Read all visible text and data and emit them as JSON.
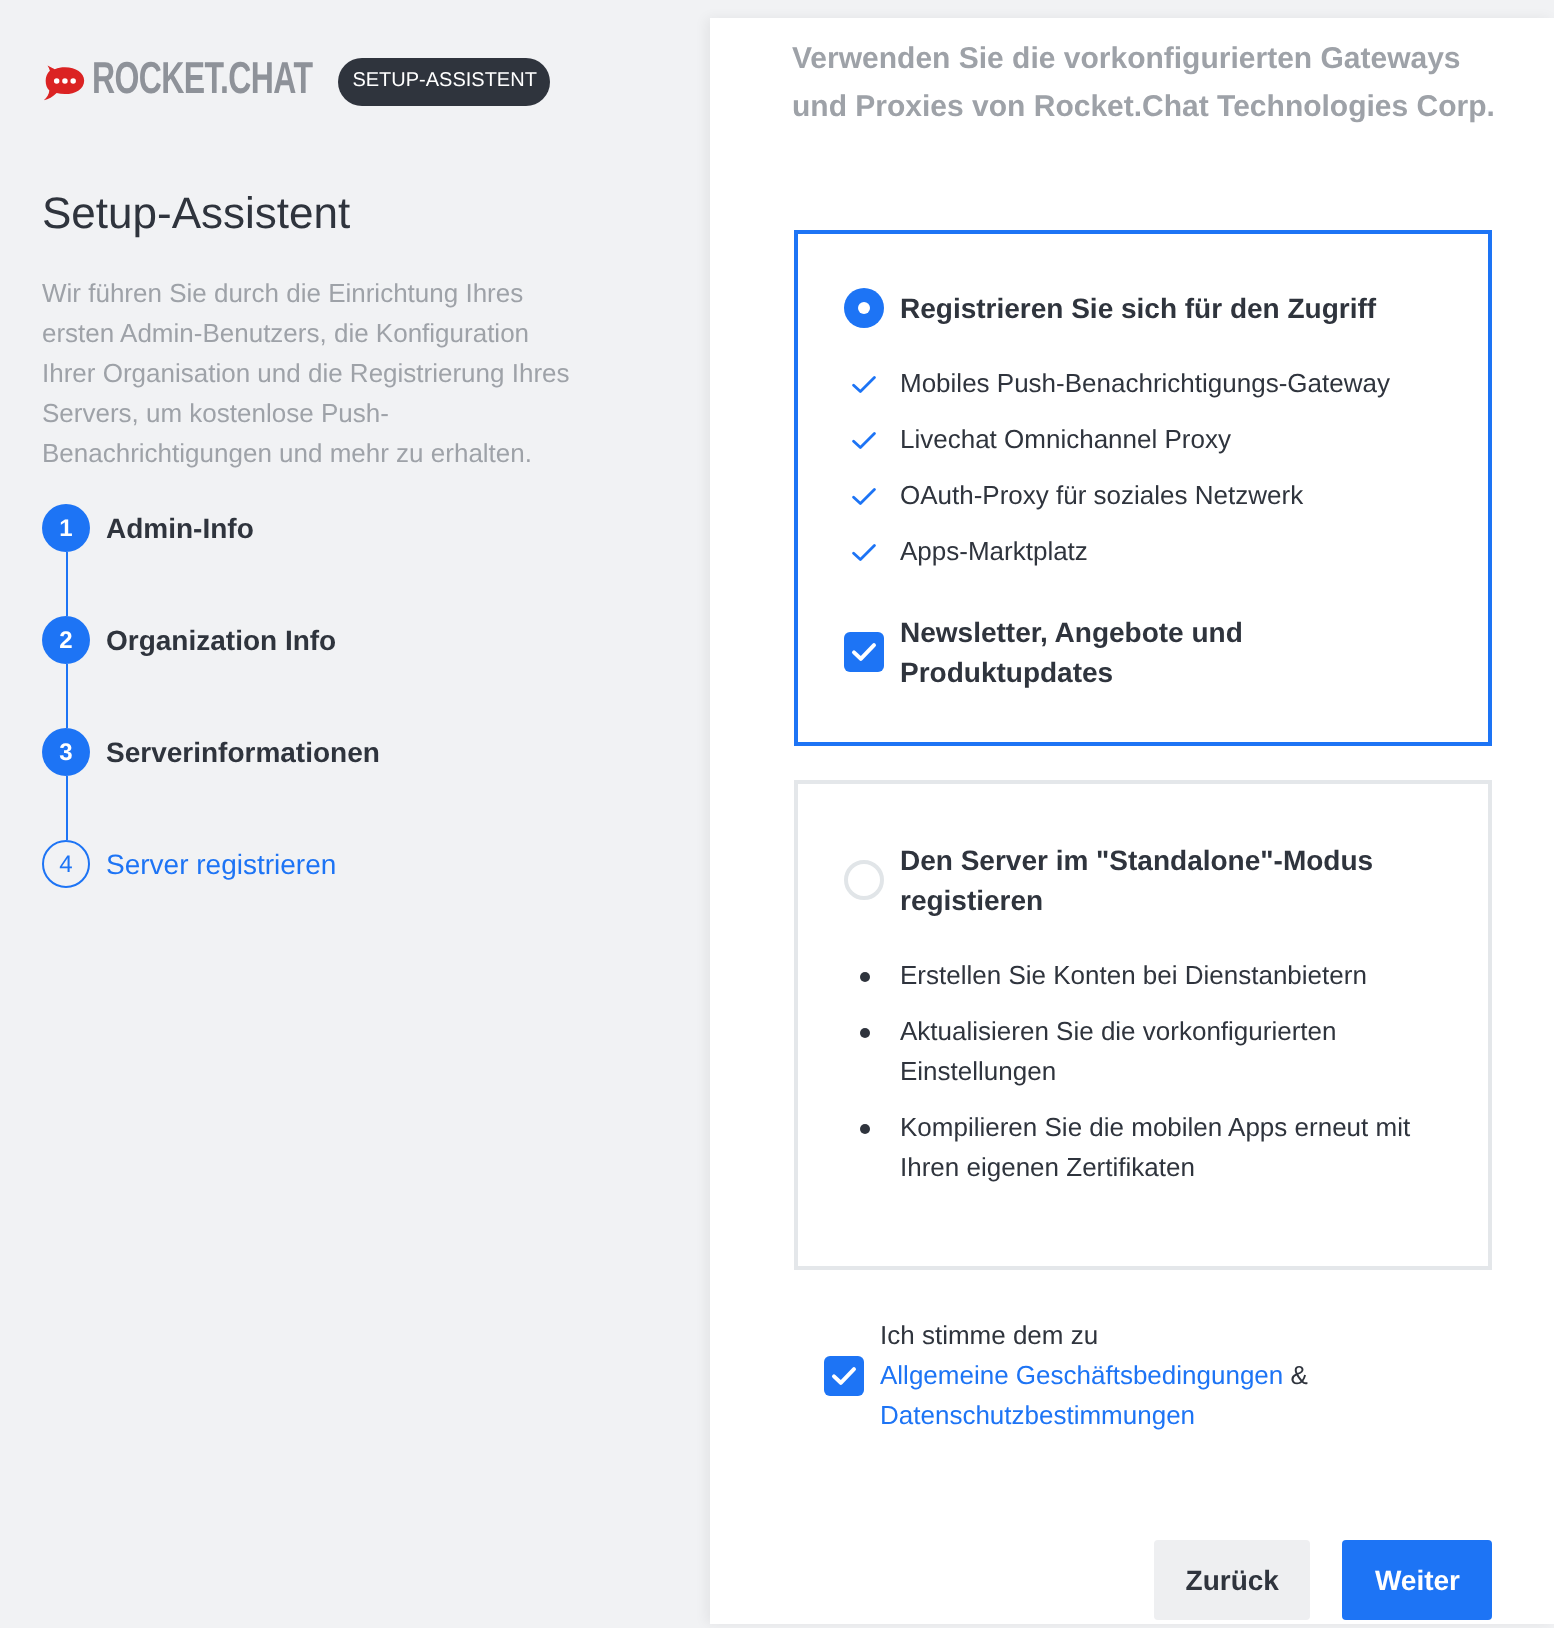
{
  "logo": {
    "wordmark": "ROCKET.CHAT",
    "badge": "SETUP-ASSISTENT"
  },
  "sidebar": {
    "title": "Setup-Assistent",
    "description": "Wir führen Sie durch die Einrichtung Ihres ersten Admin-Benutzers, die Konfiguration Ihrer Organisation und die Registrierung Ihres Servers, um kostenlose Push-Benachrichtigungen und mehr zu erhalten.",
    "steps": [
      {
        "number": "1",
        "label": "Admin-Info",
        "completed": true,
        "selected": false
      },
      {
        "number": "2",
        "label": "Organization Info",
        "completed": true,
        "selected": false
      },
      {
        "number": "3",
        "label": "Serverinformationen",
        "completed": true,
        "selected": false
      },
      {
        "number": "4",
        "label": "Server registrieren",
        "completed": false,
        "selected": true
      }
    ]
  },
  "main": {
    "intro": "Verwenden Sie die vorkonfigurierten Gateways und Proxies von Rocket.Chat Technologies Corp.",
    "options": [
      {
        "kind": "checklist",
        "title": "Registrieren Sie sich für den Zugriff",
        "selected": true,
        "features": [
          "Mobiles Push-Benachrichtigungs-Gateway",
          "Livechat Omnichannel Proxy",
          "OAuth-Proxy für soziales Netzwerk",
          "Apps-Marktplatz"
        ],
        "newsletter": {
          "label": "Newsletter, Angebote und Produktupdates",
          "checked": true
        }
      },
      {
        "kind": "bullets",
        "title": "Den Server im \"Standalone\"-Modus registieren",
        "selected": false,
        "features": [
          "Erstellen Sie Konten bei Dienstanbietern",
          "Aktualisieren Sie die vorkonfigurierten Einstellungen",
          "Kompilieren Sie die mobilen Apps erneut mit Ihren eigenen Zertifikaten"
        ]
      }
    ],
    "terms": {
      "checked": true,
      "parts": [
        {
          "kind": "text",
          "text": "Ich stimme dem zu"
        },
        {
          "kind": "link",
          "text": "Allgemeine Geschäftsbedingungen"
        },
        {
          "kind": "text",
          "text": "&"
        },
        {
          "kind": "link",
          "text": "Datenschutzbestimmungen"
        }
      ]
    },
    "buttons": [
      {
        "label": "Zurück",
        "kind": "secondary"
      },
      {
        "label": "Weiter",
        "kind": "primary"
      }
    ]
  }
}
